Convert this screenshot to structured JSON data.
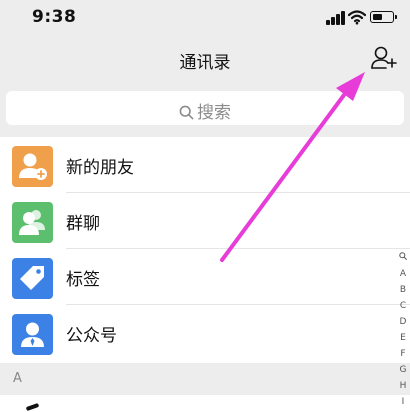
{
  "status_bar": {
    "time": "9:38"
  },
  "nav": {
    "title": "通讯录"
  },
  "search": {
    "placeholder": "搜索"
  },
  "items": [
    {
      "label": "新的朋友",
      "color": "#f0a04b"
    },
    {
      "label": "群聊",
      "color": "#5bbf6e"
    },
    {
      "label": "标签",
      "color": "#3c82e6"
    },
    {
      "label": "公众号",
      "color": "#3c82e6"
    }
  ],
  "section": {
    "label": "A"
  },
  "index_bar": [
    "A",
    "B",
    "C",
    "D",
    "E",
    "F",
    "G",
    "H",
    "I"
  ],
  "colors": {
    "annotation_arrow": "#e83cd8"
  }
}
